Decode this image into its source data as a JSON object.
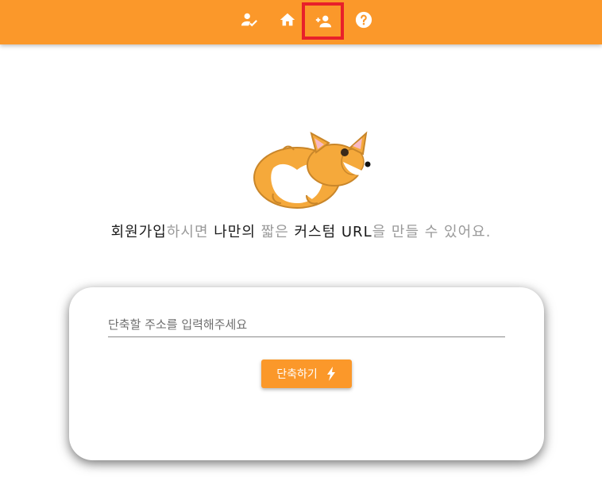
{
  "nav": {
    "items": [
      {
        "icon": "user-check-icon"
      },
      {
        "icon": "home-icon"
      },
      {
        "icon": "person-add-icon",
        "highlighted": true
      },
      {
        "icon": "help-circle-icon"
      }
    ]
  },
  "hero": {
    "mascot": "corgi-icon",
    "tagline": {
      "part1": "회원가입",
      "part2": "하시면 ",
      "part3": "나만의 ",
      "part4": "짧은 ",
      "part5": "커스텀 URL",
      "part6": "을 만들 수 있어요."
    }
  },
  "form": {
    "url_placeholder": "단축할 주소를 입력해주세요",
    "submit_label": "단축하기",
    "submit_icon": "bolt-icon"
  },
  "colors": {
    "brand": "#fb982a",
    "highlight_frame": "#e8202a"
  }
}
